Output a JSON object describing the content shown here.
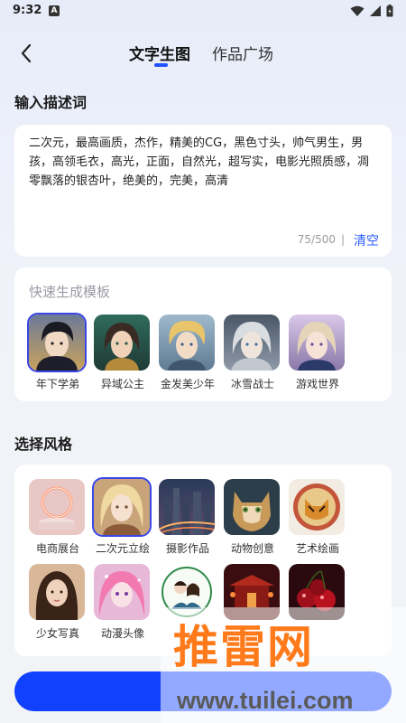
{
  "status_bar": {
    "time": "9:32",
    "notification_glyph": "A"
  },
  "nav": {
    "tabs": [
      {
        "label": "文字生图",
        "active": true
      },
      {
        "label": "作品广场",
        "active": false
      }
    ]
  },
  "prompt_section": {
    "title": "输入描述词",
    "text": "二次元，最高画质，杰作，精美的CG，黑色寸头，帅气男生，男孩，高领毛衣，高光，正面，自然光，超写实，电影光照质感，凋零飘落的银杏叶，绝美的，完美，高清",
    "counter": "75/500",
    "separator": "|",
    "clear_label": "清空"
  },
  "template_section": {
    "title": "快速生成模板",
    "items": [
      {
        "label": "年下学弟",
        "selected": true
      },
      {
        "label": "异域公主",
        "selected": false
      },
      {
        "label": "金发美少年",
        "selected": false
      },
      {
        "label": "冰雪战士",
        "selected": false
      },
      {
        "label": "游戏世界",
        "selected": false
      }
    ]
  },
  "style_section": {
    "title": "选择风格",
    "items": [
      {
        "label": "电商展台",
        "selected": false
      },
      {
        "label": "二次元立绘",
        "selected": true
      },
      {
        "label": "摄影作品",
        "selected": false
      },
      {
        "label": "动物创意",
        "selected": false
      },
      {
        "label": "艺术绘画",
        "selected": false
      },
      {
        "label": "少女写真",
        "selected": false
      },
      {
        "label": "动漫头像",
        "selected": false
      },
      {
        "label": "",
        "selected": false
      },
      {
        "label": "",
        "selected": false
      },
      {
        "label": "",
        "selected": false
      }
    ]
  },
  "watermark": {
    "brand": "推雷网",
    "url": "www.tuilei.com"
  },
  "colors": {
    "accent": "#2b5cff",
    "button": "#1141ff",
    "watermark": "#ff7a1a"
  }
}
